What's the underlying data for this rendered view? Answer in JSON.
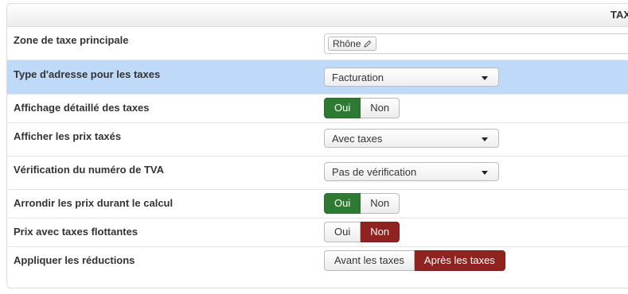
{
  "panel": {
    "title": "TAXES"
  },
  "rows": {
    "main_tax_zone": {
      "label": "Zone de taxe principale",
      "tag": "Rhône"
    },
    "address_type": {
      "label": "Type d'adresse pour les taxes",
      "value": "Facturation"
    },
    "detailed_display": {
      "label": "Affichage détaillé des taxes",
      "yes": "Oui",
      "no": "Non",
      "selected": "yes"
    },
    "show_prices": {
      "label": "Afficher les prix taxés",
      "value": "Avec taxes"
    },
    "vat_check": {
      "label": "Vérification du numéro de TVA",
      "value": "Pas de vérification"
    },
    "round_prices": {
      "label": "Arrondir les prix durant le calcul",
      "yes": "Oui",
      "no": "Non",
      "selected": "yes"
    },
    "floating_taxes": {
      "label": "Prix avec taxes flottantes",
      "yes": "Oui",
      "no": "Non",
      "selected": "no"
    },
    "apply_discounts": {
      "label": "Appliquer les réductions",
      "before": "Avant les taxes",
      "after": "Après les taxes",
      "selected": "after"
    }
  },
  "colors": {
    "highlight_row": "#bfd9f8",
    "active_yes": "#2f7a32",
    "active_no": "#8e2320"
  }
}
